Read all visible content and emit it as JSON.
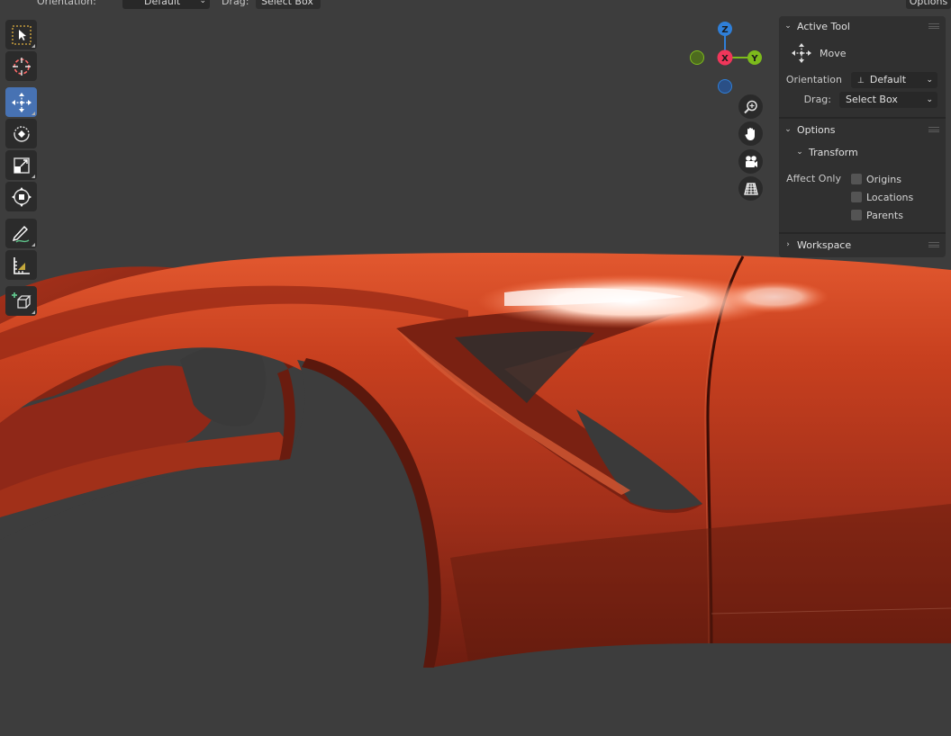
{
  "header": {
    "orientation_label": "Orientation:",
    "orientation_value": "Default",
    "drag_label": "Drag:",
    "drag_value": "Select Box",
    "options_label": "Options"
  },
  "toolbar": {
    "tools": [
      {
        "name": "select-box-tool",
        "icon": "select-box-icon",
        "active": false
      },
      {
        "name": "cursor-tool",
        "icon": "cursor-icon",
        "active": false
      },
      {
        "name": "move-tool",
        "icon": "move-icon",
        "active": true
      },
      {
        "name": "rotate-tool",
        "icon": "rotate-icon",
        "active": false
      },
      {
        "name": "scale-tool",
        "icon": "scale-icon",
        "active": false
      },
      {
        "name": "transform-tool",
        "icon": "transform-icon",
        "active": false
      },
      {
        "name": "annotate-tool",
        "icon": "annotate-icon",
        "active": false
      },
      {
        "name": "measure-tool",
        "icon": "measure-icon",
        "active": false
      },
      {
        "name": "add-cube-tool",
        "icon": "add-cube-icon",
        "active": false
      }
    ]
  },
  "gizmo": {
    "z_label": "Z",
    "x_label": "X",
    "y_label": "Y",
    "z_color": "#2f7fd8",
    "x_color": "#f0365a",
    "y_color": "#7dbb1c"
  },
  "navigation": {
    "buttons": [
      "zoom-icon",
      "hand-icon",
      "camera-icon",
      "grid-icon"
    ]
  },
  "panel": {
    "active_tool_title": "Active Tool",
    "tool_name": "Move",
    "orientation_label": "Orientation",
    "orientation_value": "Default",
    "drag_label": "Drag:",
    "drag_value": "Select Box",
    "options_title": "Options",
    "transform_title": "Transform",
    "affect_only_label": "Affect Only",
    "checkboxes": [
      {
        "label": "Origins",
        "checked": false
      },
      {
        "label": "Locations",
        "checked": false
      },
      {
        "label": "Parents",
        "checked": false
      }
    ],
    "workspace_title": "Workspace"
  },
  "colors": {
    "accent": "#4772b3",
    "car_paint": "#b83a1e",
    "viewport_bg": "#3d3d3d"
  }
}
